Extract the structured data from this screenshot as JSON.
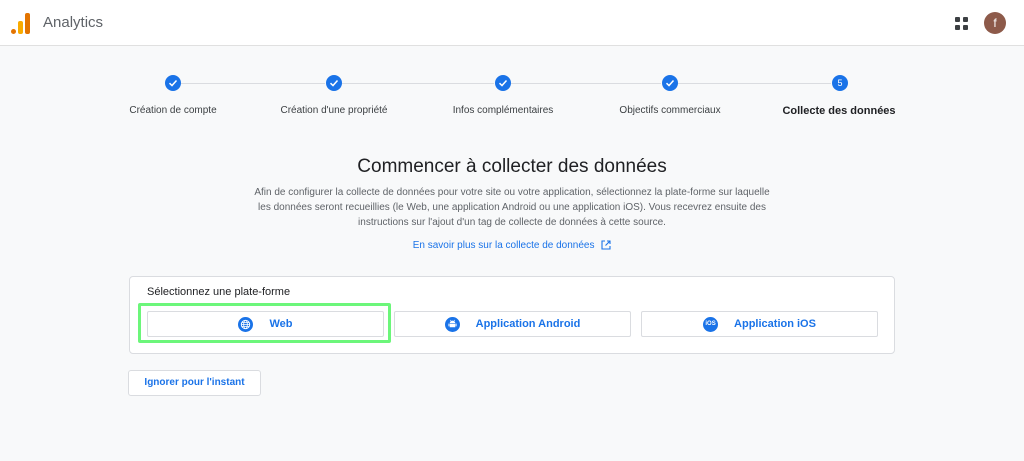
{
  "app": {
    "title": "Analytics",
    "avatar_initial": "f"
  },
  "stepper": {
    "steps": [
      {
        "label": "Création de compte",
        "state": "done"
      },
      {
        "label": "Création d'une propriété",
        "state": "done"
      },
      {
        "label": "Infos complémentaires",
        "state": "done"
      },
      {
        "label": "Objectifs commerciaux",
        "state": "done"
      },
      {
        "label": "Collecte des données",
        "state": "active",
        "number": "5"
      }
    ]
  },
  "main": {
    "title": "Commencer à collecter des données",
    "description_line1": "Afin de configurer la collecte de données pour votre site ou votre application, sélectionnez la plate-forme sur laquelle",
    "description_line2": "les données seront recueillies (le Web, une application Android ou une application iOS). Vous recevrez ensuite des",
    "description_line3": "instructions sur l'ajout d'un tag de collecte de données à cette source.",
    "learn_more": "En savoir plus sur la collecte de données"
  },
  "platform": {
    "heading": "Sélectionnez une plate-forme",
    "options": [
      {
        "label": "Web",
        "icon": "globe-icon"
      },
      {
        "label": "Application Android",
        "icon": "android-icon"
      },
      {
        "label": "Application iOS",
        "icon": "ios-icon",
        "icon_text": "iOS"
      }
    ]
  },
  "skip_label": "Ignorer pour l'instant",
  "colors": {
    "accent": "#1a73e8",
    "highlight": "#6cf67a"
  }
}
